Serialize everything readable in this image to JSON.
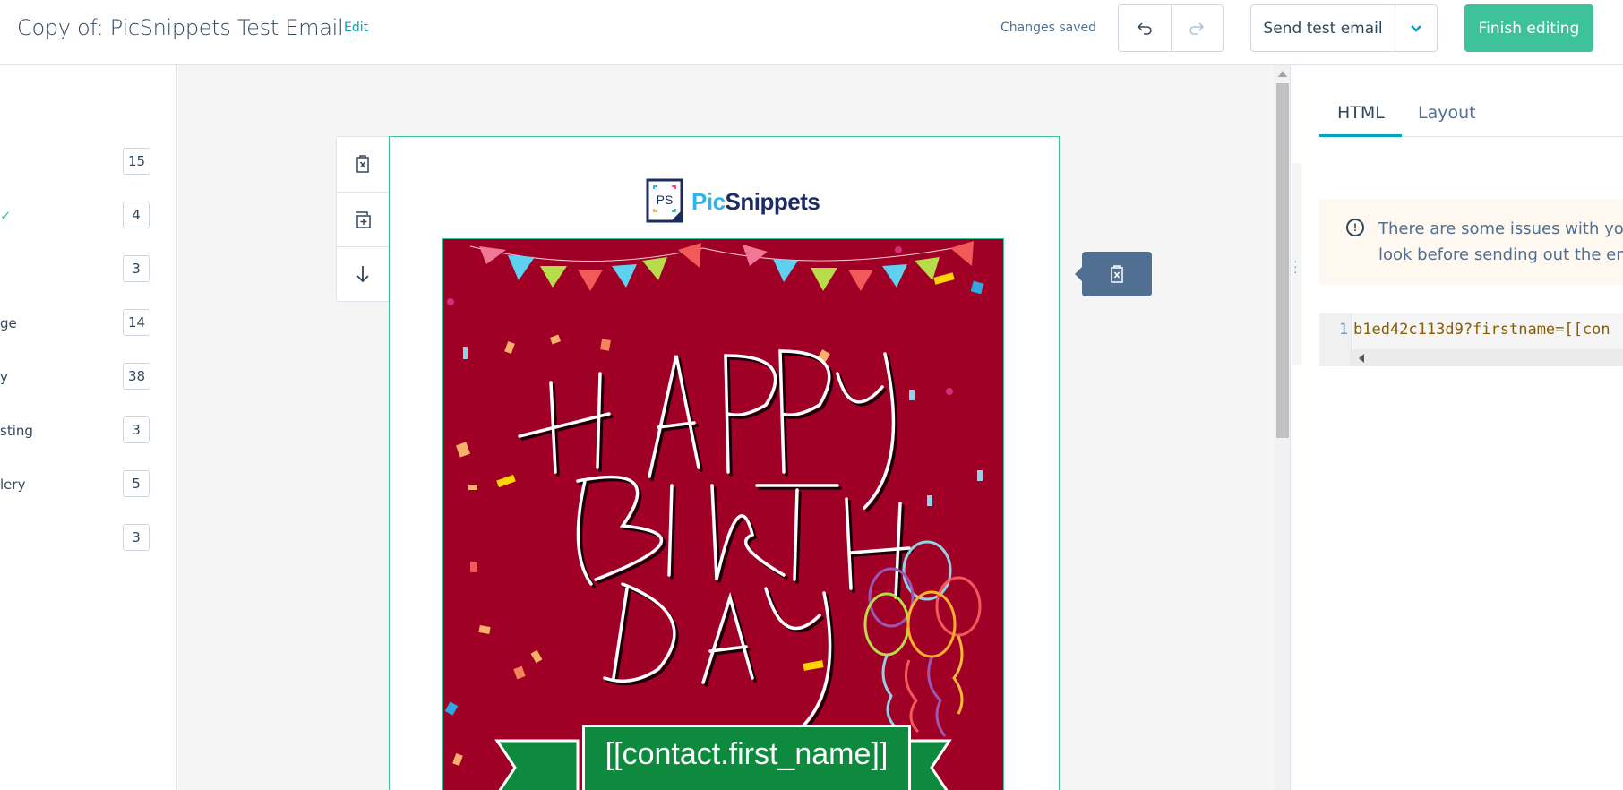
{
  "header": {
    "title": "Copy of: PicSnippets Test Email",
    "edit_label": "Edit",
    "status": "Changes saved",
    "undo_icon": "undo-icon",
    "redo_icon": "redo-icon",
    "send_test_label": "Send test email",
    "finish_label": "Finish editing",
    "accent_color": "#3dc29a",
    "link_color": "#00a4bd"
  },
  "sidebar": {
    "items": [
      {
        "label": "",
        "count": "15"
      },
      {
        "label": "✓",
        "count": "4"
      },
      {
        "label": "",
        "count": "3"
      },
      {
        "label": "ge",
        "count": "14"
      },
      {
        "label": "y",
        "count": "38"
      },
      {
        "label": "sting",
        "count": "3"
      },
      {
        "label": "lery",
        "count": "5"
      },
      {
        "label": "",
        "count": "3"
      }
    ]
  },
  "email": {
    "logo_text_pic": "Pic",
    "logo_text_snippets": "Snippets",
    "logo_mark": "PS",
    "card_bg": "#a00026",
    "merge_tag": "[[contact.first_name]]",
    "image_alt": "Happy Birthday"
  },
  "tools": [
    "delete-module-icon",
    "duplicate-module-icon",
    "move-down-icon"
  ],
  "right_panel": {
    "tabs": [
      "HTML",
      "Layout"
    ],
    "active_tab": "HTML",
    "alert_line1": "There are some issues with you",
    "alert_line2": "look before sending out the ema",
    "code_line_number": "1",
    "code_line": "b1ed42c113d9?firstname=[[con"
  }
}
